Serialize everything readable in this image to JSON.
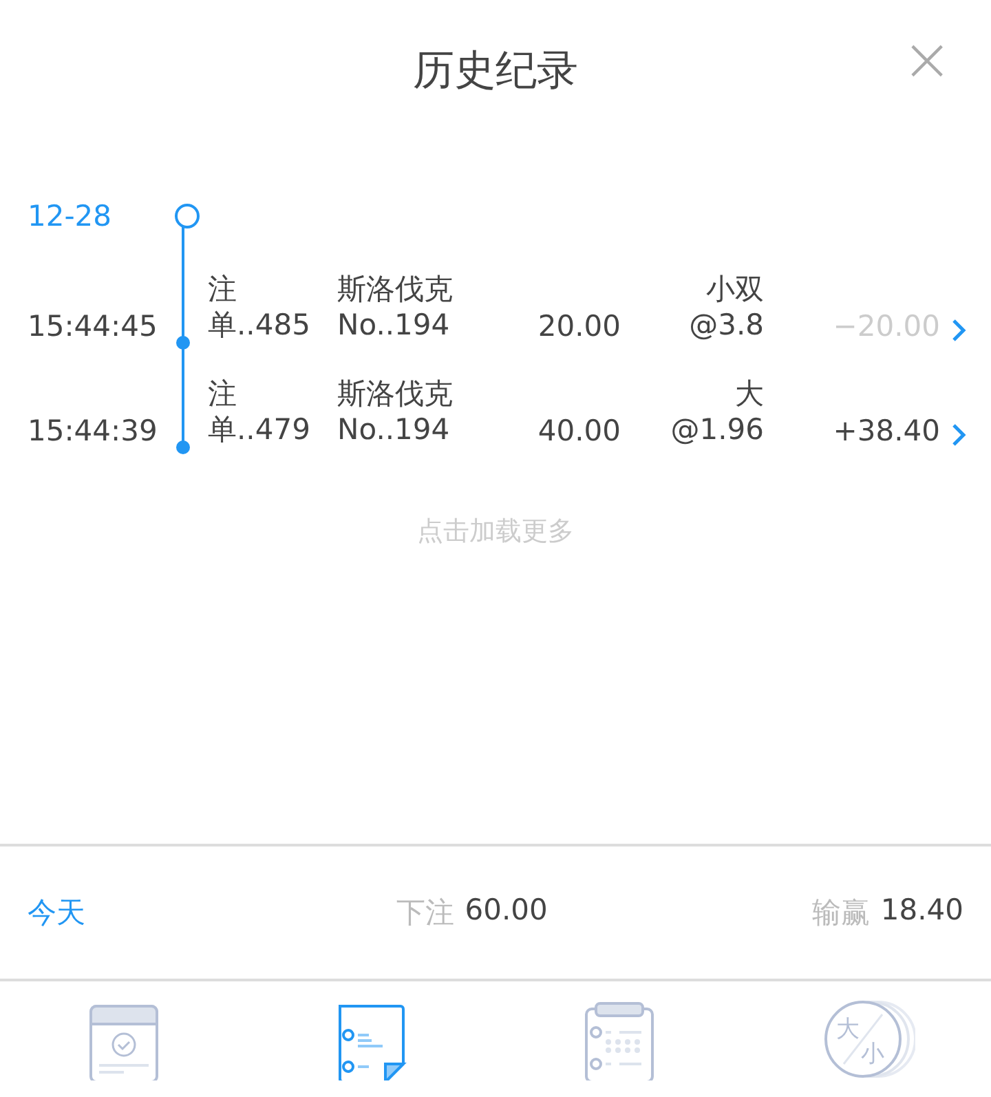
{
  "header": {
    "title": "历史纪录",
    "close": "×"
  },
  "date": "12-28",
  "records": [
    {
      "time": "15:44:45",
      "order": [
        "注",
        "单..485"
      ],
      "game": [
        "斯洛伐克",
        "No..194"
      ],
      "amount": "20.00",
      "bet": [
        "小双",
        "@3.8"
      ],
      "result": "−20.00",
      "dimmed": true
    },
    {
      "time": "15:44:39",
      "order": [
        "注",
        "单..479"
      ],
      "game": [
        "斯洛伐克",
        "No..194"
      ],
      "amount": "40.00",
      "bet": [
        "大",
        "@1.96"
      ],
      "result": "+38.40",
      "dimmed": false
    }
  ],
  "load_more": "点击加载更多",
  "summary": {
    "period": "今天",
    "stake_label": "下注",
    "stake": "60.00",
    "profit_label": "输赢",
    "profit": "18.40"
  },
  "tabs": [
    {
      "kind": "calendar",
      "selected": false
    },
    {
      "kind": "list",
      "selected": true
    },
    {
      "kind": "schedule",
      "selected": false
    },
    {
      "kind": "coin",
      "selected": false,
      "glyphs": [
        "大",
        "小"
      ]
    }
  ]
}
